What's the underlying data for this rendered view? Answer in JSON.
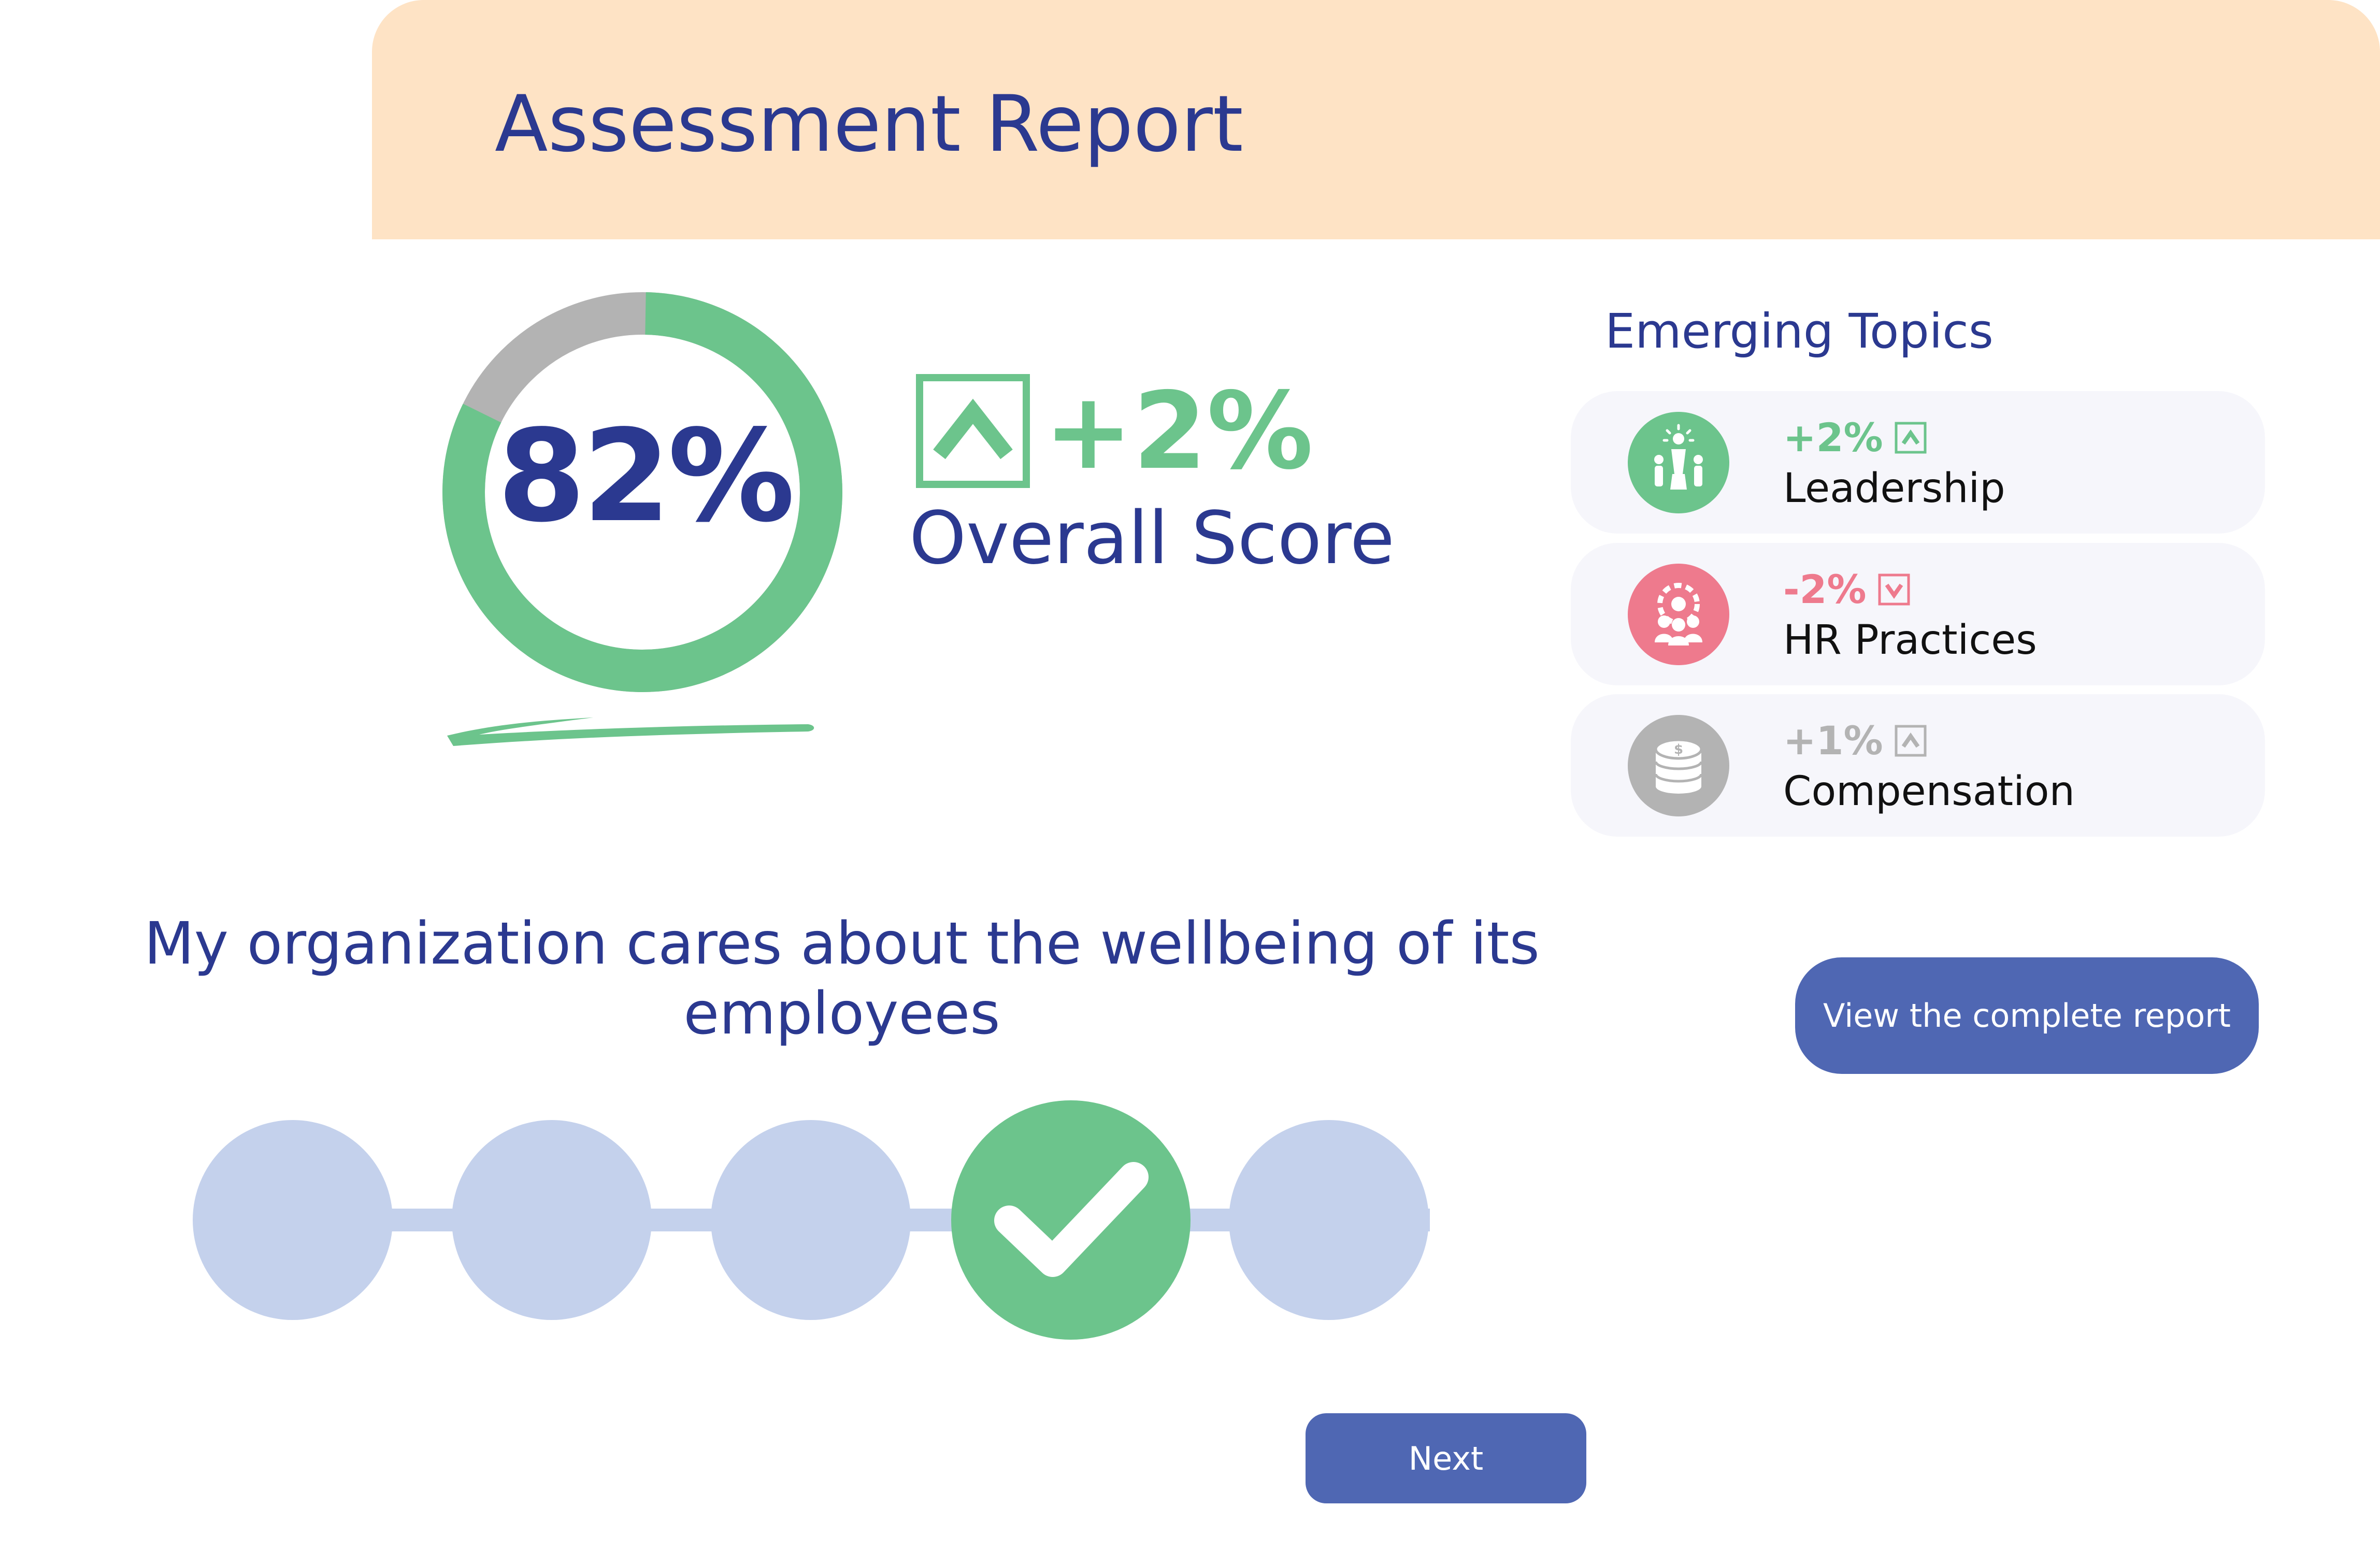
{
  "header": {
    "title": "Assessment Report"
  },
  "score": {
    "value": "82%",
    "fraction": 0.82,
    "change": "+2%",
    "change_direction": "up",
    "label": "Overall Score",
    "colors": {
      "fill": "#6cc48c",
      "rest": "#b3b3b3"
    }
  },
  "emerging_topics": {
    "title": "Emerging Topics",
    "items": [
      {
        "change": "+2%",
        "direction": "up",
        "name": "Leadership",
        "icon": "leadership-icon",
        "color": "#6cc48c"
      },
      {
        "change": "-2%",
        "direction": "down",
        "name": "HR Practices",
        "icon": "hr-practices-icon",
        "color": "#ee7a8d"
      },
      {
        "change": "+1%",
        "direction": "up",
        "name": "Compensation",
        "icon": "coin-stack-icon",
        "color": "#b3b3b3"
      }
    ]
  },
  "question": {
    "text": "My organization cares about the wellbeing of its employees"
  },
  "rating": {
    "options": 5,
    "selected": 4,
    "colors": {
      "dot": "#c4d1ec",
      "selected": "#6cc48c"
    }
  },
  "buttons": {
    "view_report": "View the complete report",
    "next": "Next"
  },
  "colors": {
    "header_bg": "#fee3c5",
    "accent_text": "#2b3990",
    "button": "#4f67b3"
  }
}
